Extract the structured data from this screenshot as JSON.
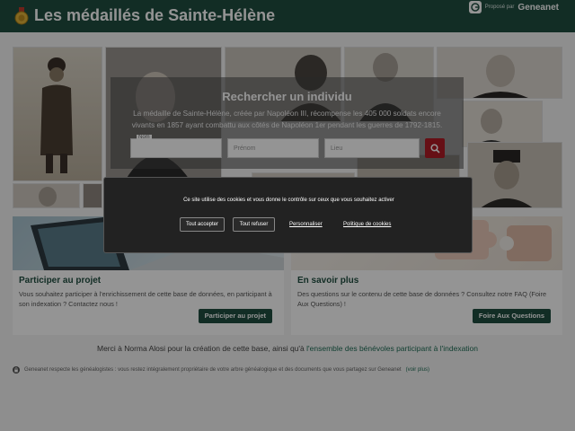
{
  "header": {
    "title": "Les médaillés de Sainte-Hélène",
    "partner_prefix": "Proposé par",
    "partner_name": "Geneanet"
  },
  "search": {
    "title": "Rechercher un individu",
    "description": "La médaille de Sainte-Hélène, créée par Napoléon III, récompense les 405 000 soldats encore vivants en 1857 ayant combattu aux côtés de Napoléon 1er pendant les guerres de 1792-1815.",
    "nom_label": "Nom",
    "nom_value": "",
    "prenom_placeholder": "Prénom",
    "lieu_placeholder": "Lieu"
  },
  "cards": [
    {
      "title": "Participer au projet",
      "text": "Vous souhaitez participer à l'enrichissement de cette base de données, en participant à son indexation ? Contactez nous !",
      "button": "Participer au projet"
    },
    {
      "title": "En savoir plus",
      "text": "Des questions sur le contenu de cette base de données ? Consultez notre FAQ (Foire Aux Questions) !",
      "button": "Foire Aux Questions"
    }
  ],
  "footer": {
    "thanks_prefix": "Merci à Norma Alosi pour la création de cette base, ainsi qu'à",
    "thanks_link": "l'ensemble des bénévoles participant à l'indexation",
    "notice_text": "Geneanet respecte les généalogistes : vous restez intégralement propriétaire de votre arbre généalogique et des documents que vous partagez sur Geneanet",
    "notice_link": "(voir plus)"
  },
  "cookie": {
    "text": "Ce site utilise des cookies et vous donne le contrôle sur ceux que vous souhaitez activer",
    "accept": "Tout accepter",
    "refuse": "Tout refuser",
    "customize": "Personnaliser",
    "policy": "Politique de cookies"
  },
  "colors": {
    "header": "#1f4e40",
    "search_button": "#b01a25",
    "cookie_bg": "#222222"
  }
}
